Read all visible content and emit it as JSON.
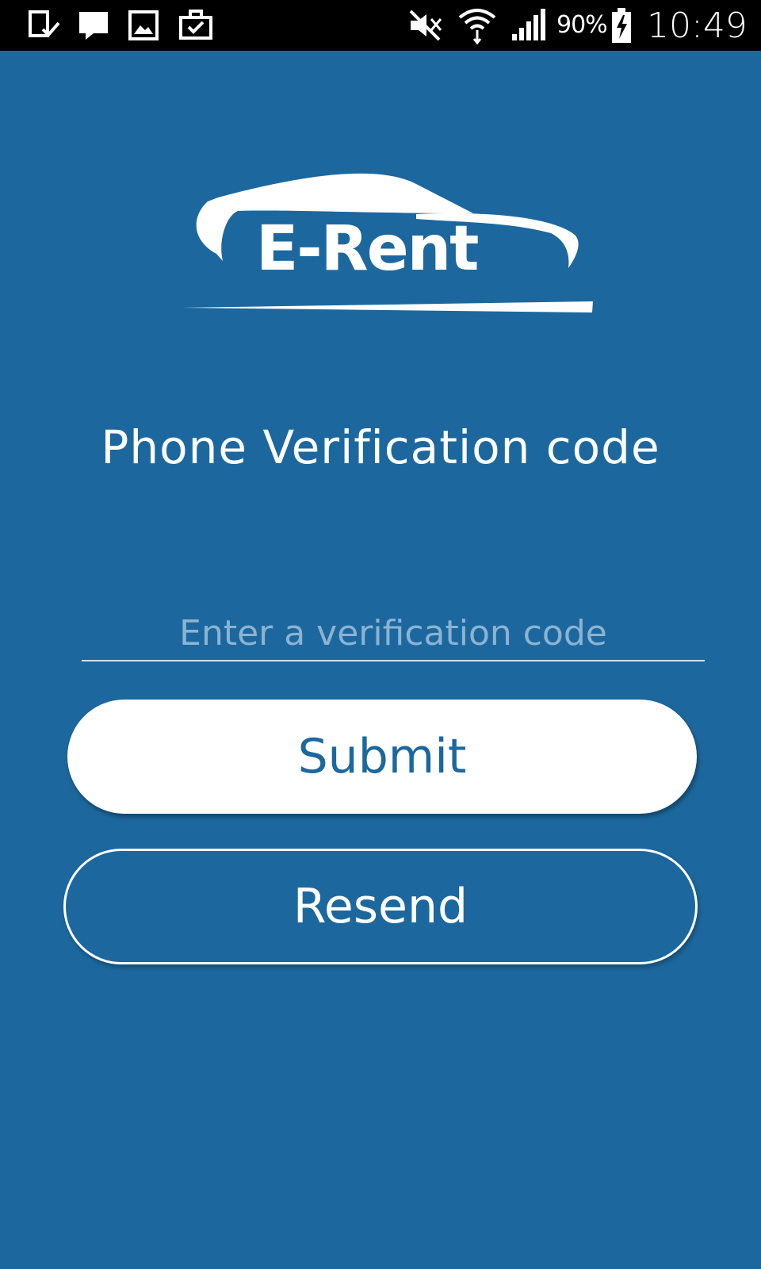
{
  "status_bar": {
    "battery_percent": "90%",
    "time": "10:49",
    "left_icons": [
      "download-done-icon",
      "message-icon",
      "gallery-icon",
      "briefcase-icon"
    ],
    "right_icons": [
      "mute-icon",
      "wifi-icon",
      "signal-icon",
      "battery-charging-icon"
    ]
  },
  "logo": {
    "brand_name": "E-Rent"
  },
  "screen": {
    "title": "Phone Verification code"
  },
  "verification_input": {
    "value": "",
    "placeholder": "Enter a verification code"
  },
  "buttons": {
    "submit_label": "Submit",
    "resend_label": "Resend"
  },
  "colors": {
    "background": "#1c689e",
    "accent": "#ffffff",
    "placeholder": "#8cb3d2"
  }
}
